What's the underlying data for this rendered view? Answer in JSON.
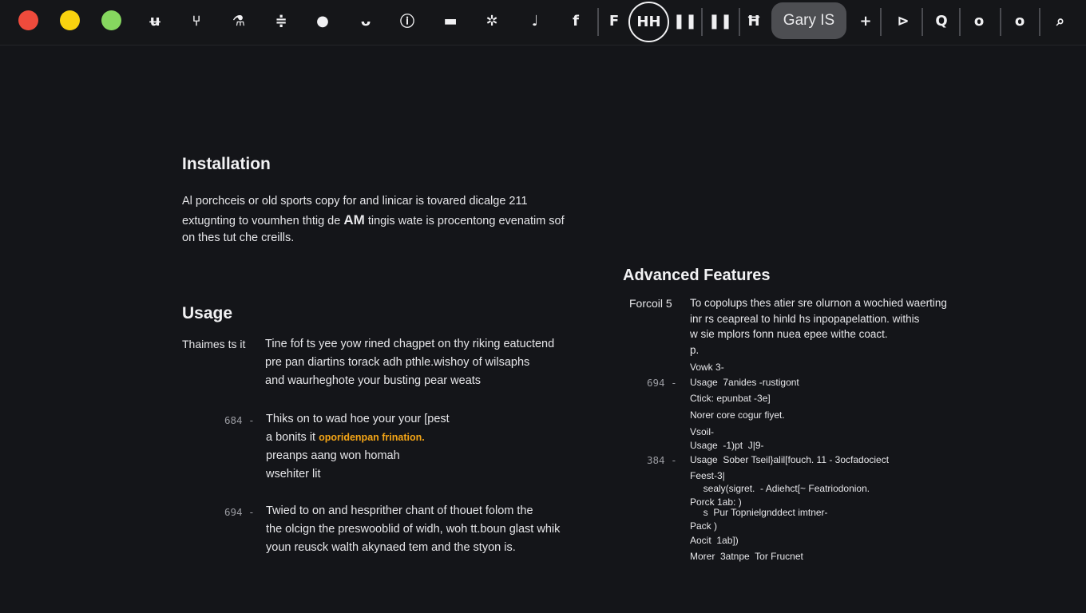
{
  "toolbar": {
    "traffic_lights": [
      {
        "name": "close",
        "color": "#ef4b3c"
      },
      {
        "name": "minimize",
        "color": "#f8d20f"
      },
      {
        "name": "maximize",
        "color": "#86d75f"
      }
    ],
    "icons": [
      {
        "name": "cup-icon",
        "glyph": "ʉ"
      },
      {
        "name": "fork-icon",
        "glyph": "⑂"
      },
      {
        "name": "flask-icon",
        "glyph": "⚗"
      },
      {
        "name": "strikethrough-icon",
        "glyph": "≑"
      },
      {
        "name": "user-icon",
        "glyph": "●"
      },
      {
        "name": "smile-icon",
        "glyph": "ᴗ"
      },
      {
        "name": "info-icon",
        "glyph": "ⓘ"
      },
      {
        "name": "gamepad-icon",
        "glyph": "▬"
      },
      {
        "name": "gear-icon",
        "glyph": "✲"
      },
      {
        "name": "note-icon",
        "glyph": "♩"
      },
      {
        "name": "font-bold-icon",
        "glyph": "f"
      },
      {
        "name": "font-icon",
        "glyph": "F"
      },
      {
        "name": "pause-icon",
        "glyph": "❚❚"
      },
      {
        "name": "pause-alt-icon",
        "glyph": "❚❚"
      },
      {
        "name": "page-icon",
        "glyph": "Ħ"
      },
      {
        "name": "plus-icon",
        "glyph": "+"
      },
      {
        "name": "play-icon",
        "glyph": "⊳"
      },
      {
        "name": "q-icon",
        "glyph": "Q"
      },
      {
        "name": "record-icon",
        "glyph": "o"
      },
      {
        "name": "record-alt-icon",
        "glyph": "o"
      },
      {
        "name": "search-icon",
        "glyph": "⌕"
      }
    ],
    "heading_button": "HH",
    "user_pill": "Gary  IS"
  },
  "installation": {
    "title": "Installation",
    "lines": [
      "Al porchceis or old sports copy for and linicar is tovared dicalge  211",
      [
        "extugnting to voumhen thtig de ",
        "AM",
        " tingis wate is procentong  evenatim sof"
      ],
      "on thes tut che creills."
    ]
  },
  "usage": {
    "title": "Usage",
    "label": "Thaimes ts it",
    "lines": [
      "Tine fof ts yee yow rined chagpet on thy riking eatuctend",
      "pre pan diartins torack adh pthle.wishoy of wilsaphs",
      "and waurheghote your busting pear weats"
    ],
    "items": [
      {
        "num": "684 -",
        "lines": [
          "Thiks on to wad hoe your your [pest",
          [
            "a bonits  it ",
            "oporidenpan frination."
          ],
          "preanps aang  won homah",
          "wsehiter  lit"
        ]
      },
      {
        "num": "694 -",
        "lines": [
          "Twied to on and hesprither chant of thouet folom the",
          "the olcign the preswooblid of widh, woh tt.boun glast whik",
          "youn reusck walth akynaed tem and the styon is."
        ]
      }
    ]
  },
  "advanced": {
    "title": "Advanced Features",
    "label": "Forcoil 5",
    "lines": [
      "To copolups thes atier sre olurnon a wochied waerting",
      "inr rs ceapreal to hinld hs inpopapelattion. withis",
      "w sie mplors fonn nuea epee withe coact.",
      "p."
    ],
    "list": [
      {
        "num": "",
        "text": "Vowk 3-"
      },
      {
        "num": "694 -",
        "text": "Usage  7anides -rustigont"
      },
      {
        "num": "",
        "text": "Ctick: epunbat -3e]"
      },
      {
        "num": "",
        "text": "Norer core cogur fiyet."
      },
      {
        "num": "",
        "text": "Vsoil-"
      },
      {
        "num": "",
        "text": "Usage  -1)pt  J|9-"
      },
      {
        "num": "384 -",
        "text": "Usage  Sober Tseil}alil[fouch. 11 - 3ocfadociect"
      },
      {
        "num": "",
        "text": "Feest-3|"
      },
      {
        "num": "",
        "text": "     sealy(sigret.  - Adiehct[~ Featriodonion."
      },
      {
        "num": "",
        "text": "Porck 1ab: )"
      },
      {
        "num": "",
        "text": "     s  Pur Topnielgnddect imtner-"
      },
      {
        "num": "",
        "text": "Pack )"
      },
      {
        "num": "",
        "text": "Aocit  1ab])"
      },
      {
        "num": "",
        "text": "Morer  3atnpe  Tor Frucnet"
      }
    ]
  }
}
